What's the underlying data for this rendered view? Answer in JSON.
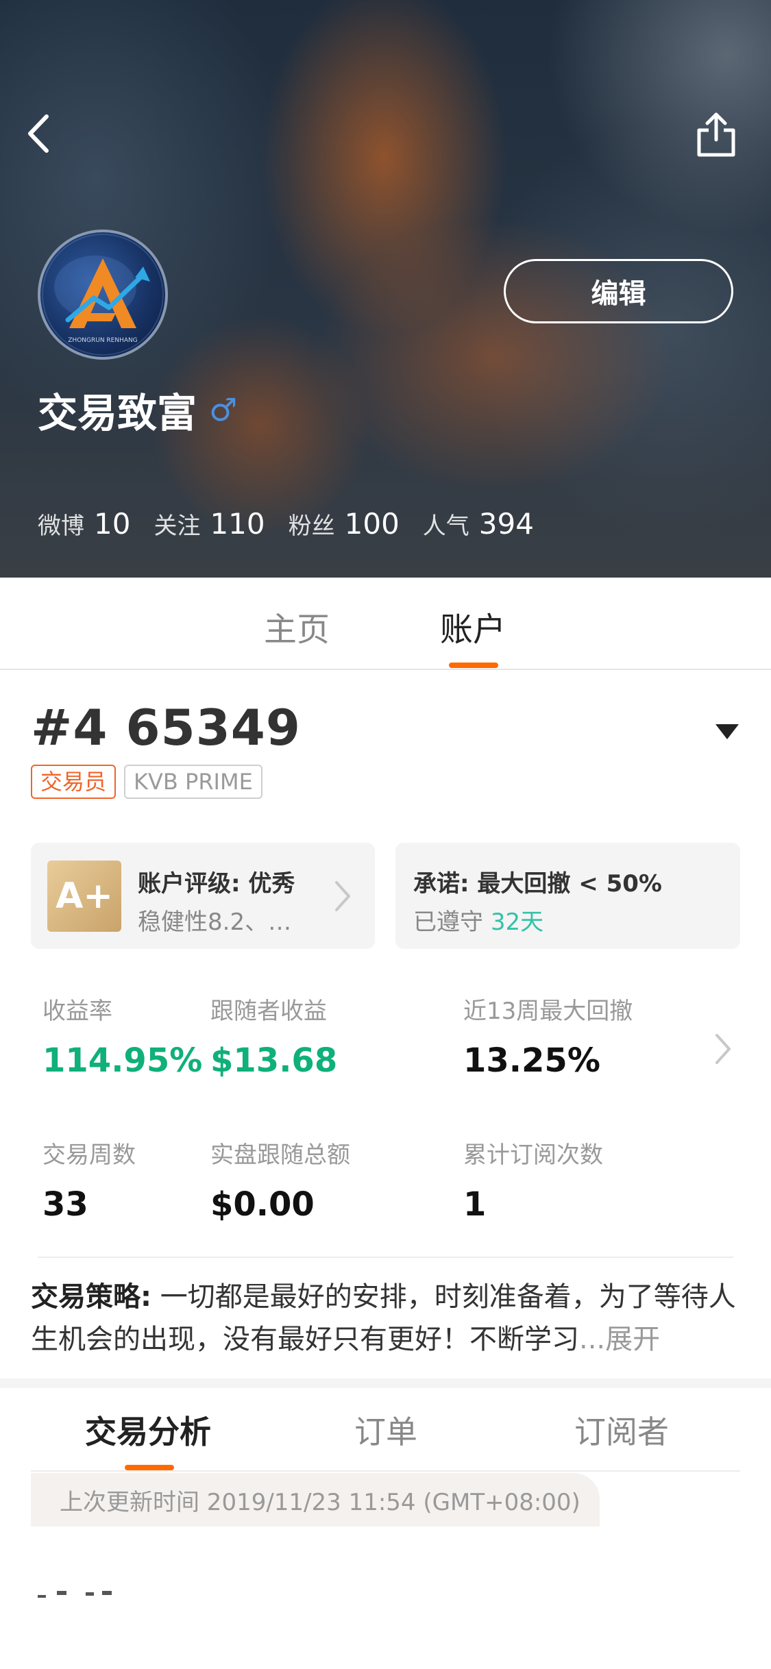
{
  "profile": {
    "name": "交易致富",
    "gender_symbol": "♂",
    "avatar_text": "ZHONGRUN RENHANG",
    "edit_label": "编辑",
    "stats": [
      {
        "label": "微博",
        "value": "10"
      },
      {
        "label": "关注",
        "value": "110"
      },
      {
        "label": "粉丝",
        "value": "100"
      },
      {
        "label": "人气",
        "value": "394"
      }
    ]
  },
  "top_tabs": [
    {
      "label": "主页",
      "active": false
    },
    {
      "label": "账户",
      "active": true
    }
  ],
  "account": {
    "number": "#4 65349",
    "badges": [
      "交易员",
      "KVB PRIME"
    ]
  },
  "cards": {
    "rating": {
      "grade": "A+",
      "title": "账户评级: 优秀",
      "subtitle": "稳健性8.2、…"
    },
    "promise": {
      "title": "承诺: 最大回撤 < 50%",
      "kept_label": "已遵守",
      "kept_days": "32天"
    }
  },
  "metrics": [
    {
      "label": "收益率",
      "value": "114.95%"
    },
    {
      "label": "跟随者收益",
      "value": "$13.68"
    },
    {
      "label": "近13周最大回撤",
      "value": "13.25%"
    },
    {
      "label": "交易周数",
      "value": "33"
    },
    {
      "label": "实盘跟随总额",
      "value": "$0.00"
    },
    {
      "label": "累计订阅次数",
      "value": "1"
    }
  ],
  "strategy": {
    "label": "交易策略:",
    "text": "一切都是最好的安排，时刻准备着，为了等待人生机会的出现，没有最好只有更好！不断学习",
    "expand": "...展开"
  },
  "bottom_tabs": [
    {
      "label": "交易分析",
      "active": true
    },
    {
      "label": "订单",
      "active": false
    },
    {
      "label": "订阅者",
      "active": false
    }
  ],
  "update_time": "上次更新时间 2019/11/23 11:54 (GMT+08:00)",
  "colors": {
    "accent": "#ff6a00",
    "positive": "#0fb07a",
    "teal": "#33c2a8",
    "gender": "#4a90e2",
    "trader_badge": "#f0652a"
  }
}
